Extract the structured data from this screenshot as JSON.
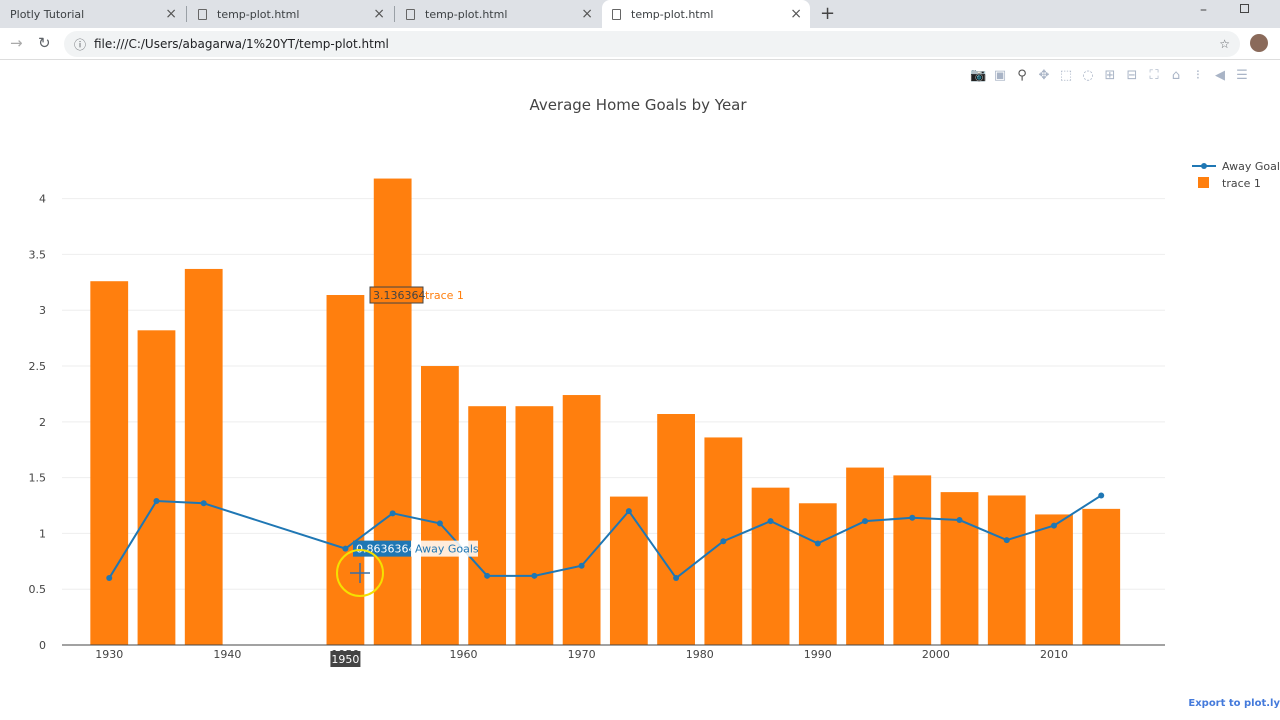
{
  "browser": {
    "tabs": [
      {
        "label": "Plotly Tutorial"
      },
      {
        "label": "temp-plot.html"
      },
      {
        "label": "temp-plot.html"
      },
      {
        "label": "temp-plot.html",
        "active": true
      }
    ],
    "url": "file:///C:/Users/abagarwa/1%20YT/temp-plot.html"
  },
  "modebar": {
    "icons": [
      "camera-icon",
      "save-icon",
      "zoom-icon",
      "pan-icon",
      "box-select-icon",
      "lasso-icon",
      "zoom-in-icon",
      "zoom-out-icon",
      "autoscale-icon",
      "home-icon",
      "spike-lines-icon",
      "hover-closest-icon",
      "hover-compare-icon"
    ]
  },
  "export_link": "Export to plot.ly",
  "colors": {
    "bar": "#ff7f0e",
    "line": "#1f77b4"
  },
  "chart_data": {
    "type": "bar+line",
    "title": "Average Home Goals by Year",
    "x": [
      1930,
      1934,
      1938,
      1950,
      1954,
      1958,
      1962,
      1966,
      1970,
      1974,
      1978,
      1982,
      1986,
      1990,
      1994,
      1998,
      2002,
      2006,
      2010,
      2014
    ],
    "series": [
      {
        "name": "Away Goals",
        "type": "line",
        "values": [
          0.6,
          1.29,
          1.27,
          0.8636364,
          1.18,
          1.09,
          0.62,
          0.62,
          0.71,
          1.2,
          0.6,
          0.93,
          1.11,
          0.91,
          1.11,
          1.14,
          1.12,
          0.94,
          1.07,
          1.34
        ]
      },
      {
        "name": "trace 1",
        "type": "bar",
        "values": [
          3.26,
          2.82,
          3.37,
          3.136364,
          4.18,
          2.5,
          2.14,
          2.14,
          2.24,
          1.33,
          2.07,
          1.86,
          1.41,
          1.27,
          1.59,
          1.52,
          1.37,
          1.34,
          1.17,
          1.22
        ]
      }
    ],
    "xticks": [
      1930,
      1940,
      1950,
      1960,
      1970,
      1980,
      1990,
      2000,
      2010
    ],
    "yticks": [
      0,
      0.5,
      1,
      1.5,
      2,
      2.5,
      3,
      3.5,
      4
    ],
    "xlim": [
      1926,
      2019.4
    ],
    "ylim": [
      0,
      4.4
    ],
    "grid": true,
    "legend": "top-right",
    "hover": {
      "x_label": "1950",
      "bar_label": "3.136364",
      "line_label": "0.8636364"
    }
  }
}
